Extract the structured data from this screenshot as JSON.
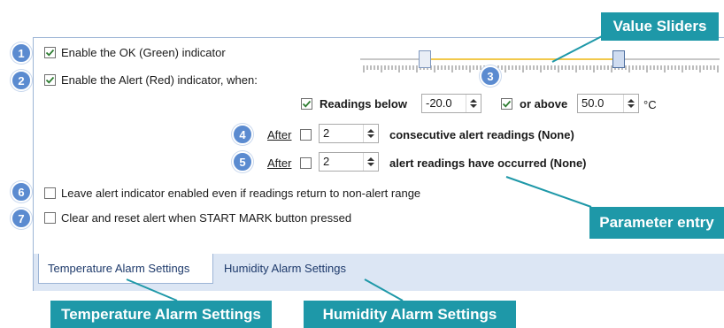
{
  "options": {
    "enable_ok": {
      "label": "Enable the OK (Green) indicator",
      "checked": true
    },
    "enable_alert": {
      "label": "Enable the Alert (Red) indicator, when:",
      "checked": true
    },
    "leave_alert": {
      "label": "Leave alert indicator enabled even if readings return to non-alert range",
      "checked": false
    },
    "clear_reset": {
      "label": "Clear and reset alert when START MARK button pressed",
      "checked": false
    }
  },
  "readings": {
    "below": {
      "label": "Readings below",
      "checked": true,
      "value": "-20.0"
    },
    "above": {
      "label": "or above",
      "checked": true,
      "value": "50.0"
    },
    "unit": "°C"
  },
  "after1": {
    "label": "After",
    "checked": false,
    "value": "2",
    "suffix": "consecutive alert readings (None)"
  },
  "after2": {
    "label": "After",
    "checked": false,
    "value": "2",
    "suffix": "alert readings have occurred (None)"
  },
  "tabs": [
    "Temperature Alarm Settings",
    "Humidity Alarm Settings"
  ],
  "badges": [
    "1",
    "2",
    "3",
    "4",
    "5",
    "6",
    "7"
  ],
  "callouts": {
    "value_sliders": "Value Sliders",
    "parameter_entry": "Parameter entry",
    "temperature_tab": "Temperature Alarm Settings",
    "humidity_tab": "Humidity Alarm Settings"
  },
  "colors": {
    "accent": "#1e98a8",
    "badge": "#5b8bd0",
    "slider_fill": "#f2c94c",
    "check": "#2e7d32"
  }
}
